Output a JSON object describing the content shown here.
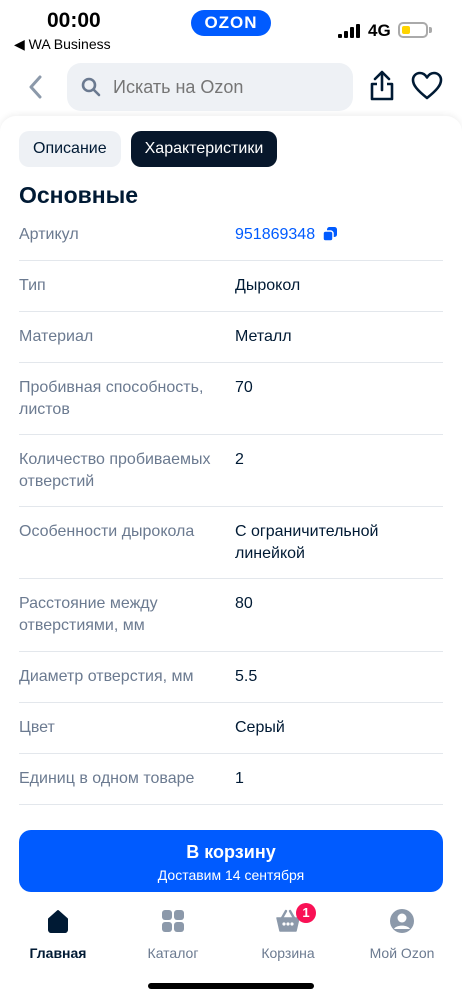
{
  "status": {
    "time": "00:00",
    "back_app": "◀ WA Business",
    "logo": "OZON",
    "network": "4G",
    "battery_level": 0.25
  },
  "nav": {
    "search_placeholder": "Искать на Ozon"
  },
  "tabs": [
    {
      "label": "Описание",
      "active": false
    },
    {
      "label": "Характеристики",
      "active": true
    }
  ],
  "section_title": "Основные",
  "specs": [
    {
      "key": "Артикул",
      "value": "951869348",
      "link": true
    },
    {
      "key": "Тип",
      "value": "Дырокол"
    },
    {
      "key": "Материал",
      "value": "Металл"
    },
    {
      "key": "Пробивная способность, листов",
      "value": "70"
    },
    {
      "key": "Количество пробиваемых отверстий",
      "value": "2"
    },
    {
      "key": "Особенности дырокола",
      "value": "С ограничительной линейкой"
    },
    {
      "key": "Расстояние между отверстиями, мм",
      "value": "80"
    },
    {
      "key": "Диаметр отверстия, мм",
      "value": "5.5"
    },
    {
      "key": "Цвет",
      "value": "Серый"
    },
    {
      "key": "Единиц в одном товаре",
      "value": "1"
    }
  ],
  "cart_button": {
    "label": "В корзину",
    "sublabel": "Доставим 14 сентября"
  },
  "bottom_nav": [
    {
      "label": "Главная",
      "icon": "home-icon",
      "active": true
    },
    {
      "label": "Каталог",
      "icon": "catalog-icon",
      "active": false
    },
    {
      "label": "Корзина",
      "icon": "basket-icon",
      "active": false
    },
    {
      "label": "Мой Ozon",
      "icon": "profile-icon",
      "active": false
    }
  ],
  "cart_badge": "1",
  "colors": {
    "brand": "#005bff",
    "dark": "#001a34",
    "muted": "#6b7a90",
    "badge": "#f91155"
  }
}
